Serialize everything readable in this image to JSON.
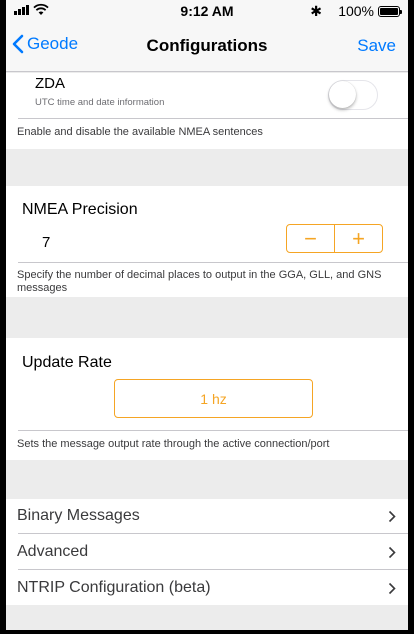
{
  "status_bar": {
    "time": "9:12 AM",
    "bluetooth": "✱",
    "battery_percent": "100%",
    "icons": [
      "signal-icon",
      "wifi-icon",
      "bluetooth-icon",
      "battery-icon"
    ]
  },
  "nav": {
    "back_label": "Geode",
    "title": "Configurations",
    "save_label": "Save"
  },
  "nmea_sentences": {
    "name": "ZDA",
    "description": "UTC time and date information",
    "enabled": false,
    "footer": "Enable and disable the available NMEA sentences"
  },
  "precision": {
    "title": "NMEA Precision",
    "value": "7",
    "minus": "−",
    "plus": "+",
    "footer": "Specify the number of decimal places to output in the GGA, GLL, and GNS messages"
  },
  "update_rate": {
    "title": "Update Rate",
    "value": "1 hz",
    "footer": "Sets the message output rate through the active connection/port"
  },
  "menu": {
    "items": [
      {
        "label": "Binary Messages"
      },
      {
        "label": "Advanced"
      },
      {
        "label": "NTRIP Configuration (beta)"
      }
    ]
  },
  "colors": {
    "accent_blue": "#007aff",
    "accent_orange": "#f5a524",
    "group_background": "#ececec"
  }
}
